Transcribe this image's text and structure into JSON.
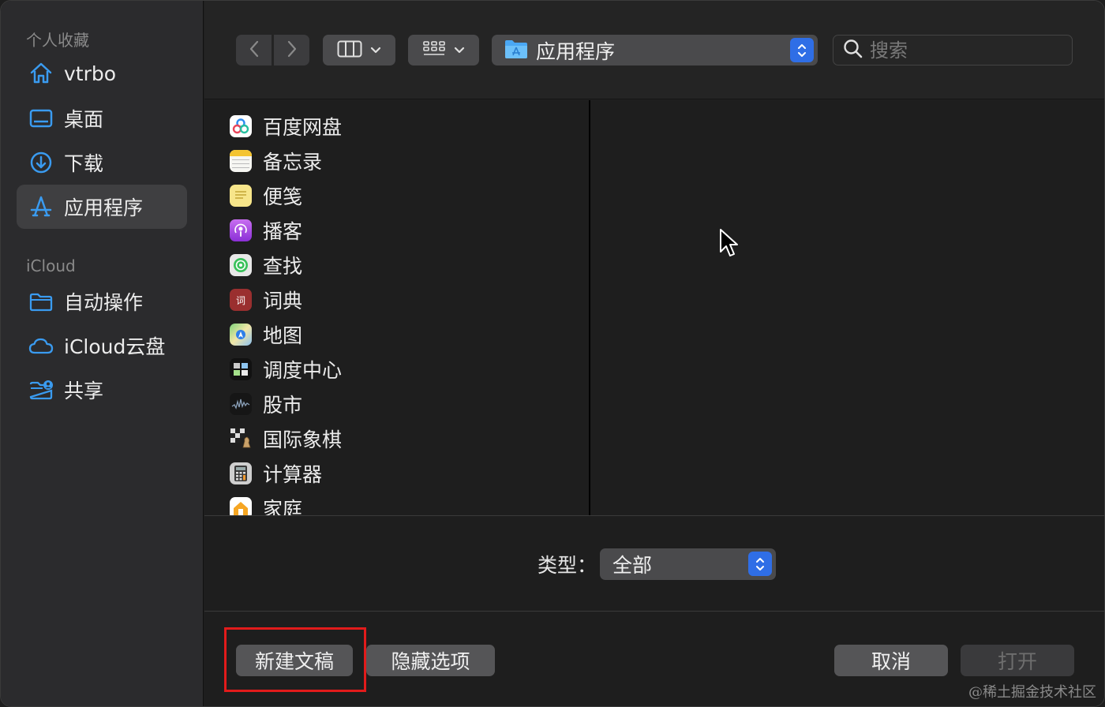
{
  "sidebar": {
    "sections": [
      {
        "title": "个人收藏"
      },
      {
        "title": "iCloud"
      }
    ],
    "items": [
      {
        "label": "vtrbo",
        "icon": "home-icon"
      },
      {
        "label": "桌面",
        "icon": "desktop-icon"
      },
      {
        "label": "下载",
        "icon": "download-icon"
      },
      {
        "label": "应用程序",
        "icon": "applications-icon",
        "selected": true
      },
      {
        "label": "自动操作",
        "icon": "folder-icon"
      },
      {
        "label": "iCloud云盘",
        "icon": "cloud-icon"
      },
      {
        "label": "共享",
        "icon": "shared-folder-icon"
      }
    ]
  },
  "toolbar": {
    "path": "应用程序",
    "search_placeholder": "搜索"
  },
  "files": [
    {
      "name": "百度网盘",
      "icon": "baidu-netdisk-icon"
    },
    {
      "name": "备忘录",
      "icon": "notes-icon"
    },
    {
      "name": "便笺",
      "icon": "stickies-icon"
    },
    {
      "name": "播客",
      "icon": "podcasts-icon"
    },
    {
      "name": "查找",
      "icon": "find-my-icon"
    },
    {
      "name": "词典",
      "icon": "dictionary-icon",
      "glyph": "词"
    },
    {
      "name": "地图",
      "icon": "maps-icon"
    },
    {
      "name": "调度中心",
      "icon": "mission-control-icon"
    },
    {
      "name": "股市",
      "icon": "stocks-icon"
    },
    {
      "name": "国际象棋",
      "icon": "chess-icon"
    },
    {
      "name": "计算器",
      "icon": "calculator-icon"
    },
    {
      "name": "家庭",
      "icon": "home-app-icon"
    }
  ],
  "options": {
    "type_label": "类型：",
    "type_value": "全部"
  },
  "buttons": {
    "new_document": "新建文稿",
    "hide_options": "隐藏选项",
    "cancel": "取消",
    "open": "打开"
  },
  "watermark": "@稀土掘金技术社区",
  "colors": {
    "accent": "#2f6ee6",
    "sidebar_icon": "#3a9bf0",
    "highlight": "#e21b1b"
  }
}
